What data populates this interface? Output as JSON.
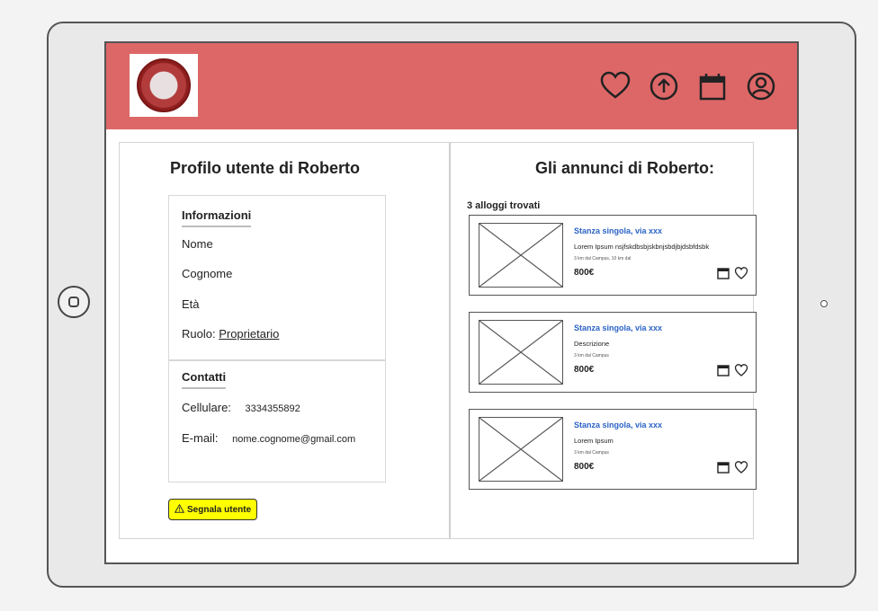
{
  "profile": {
    "title": "Profilo utente di Roberto",
    "info_header": "Informazioni",
    "name_label": "Nome",
    "surname_label": "Cognome",
    "age_label": "Età",
    "role_label": "Ruolo:",
    "role_value": "Proprietario",
    "contacts_header": "Contatti",
    "phone_label": "Cellulare:",
    "phone_value": "3334355892",
    "email_label": "E-mail:",
    "email_value": "nome.cognome@gmail.com",
    "report_button": "Segnala utente"
  },
  "header": {
    "icons": [
      "heart-icon",
      "upload-icon",
      "calendar-icon",
      "user-icon"
    ],
    "color": "#dd6767"
  },
  "listings": {
    "title": "Gli annunci di Roberto:",
    "count": "3 alloggi trovati",
    "items": [
      {
        "title": "Stanza singola, via xxx",
        "description": "Lorem Ipsum nsjfskdbsbjskbnjsbdjbjdsbfdsbk",
        "distance": "3 km dal Campus, 10 km dal",
        "price": "800€"
      },
      {
        "title": "Stanza singola, via xxx",
        "description": "Descrizione",
        "distance": "3 km dal Campus",
        "price": "800€"
      },
      {
        "title": "Stanza singola, via xxx",
        "description": "Lorem Ipsum",
        "distance": "3 km dal Campus",
        "price": "800€"
      }
    ]
  }
}
